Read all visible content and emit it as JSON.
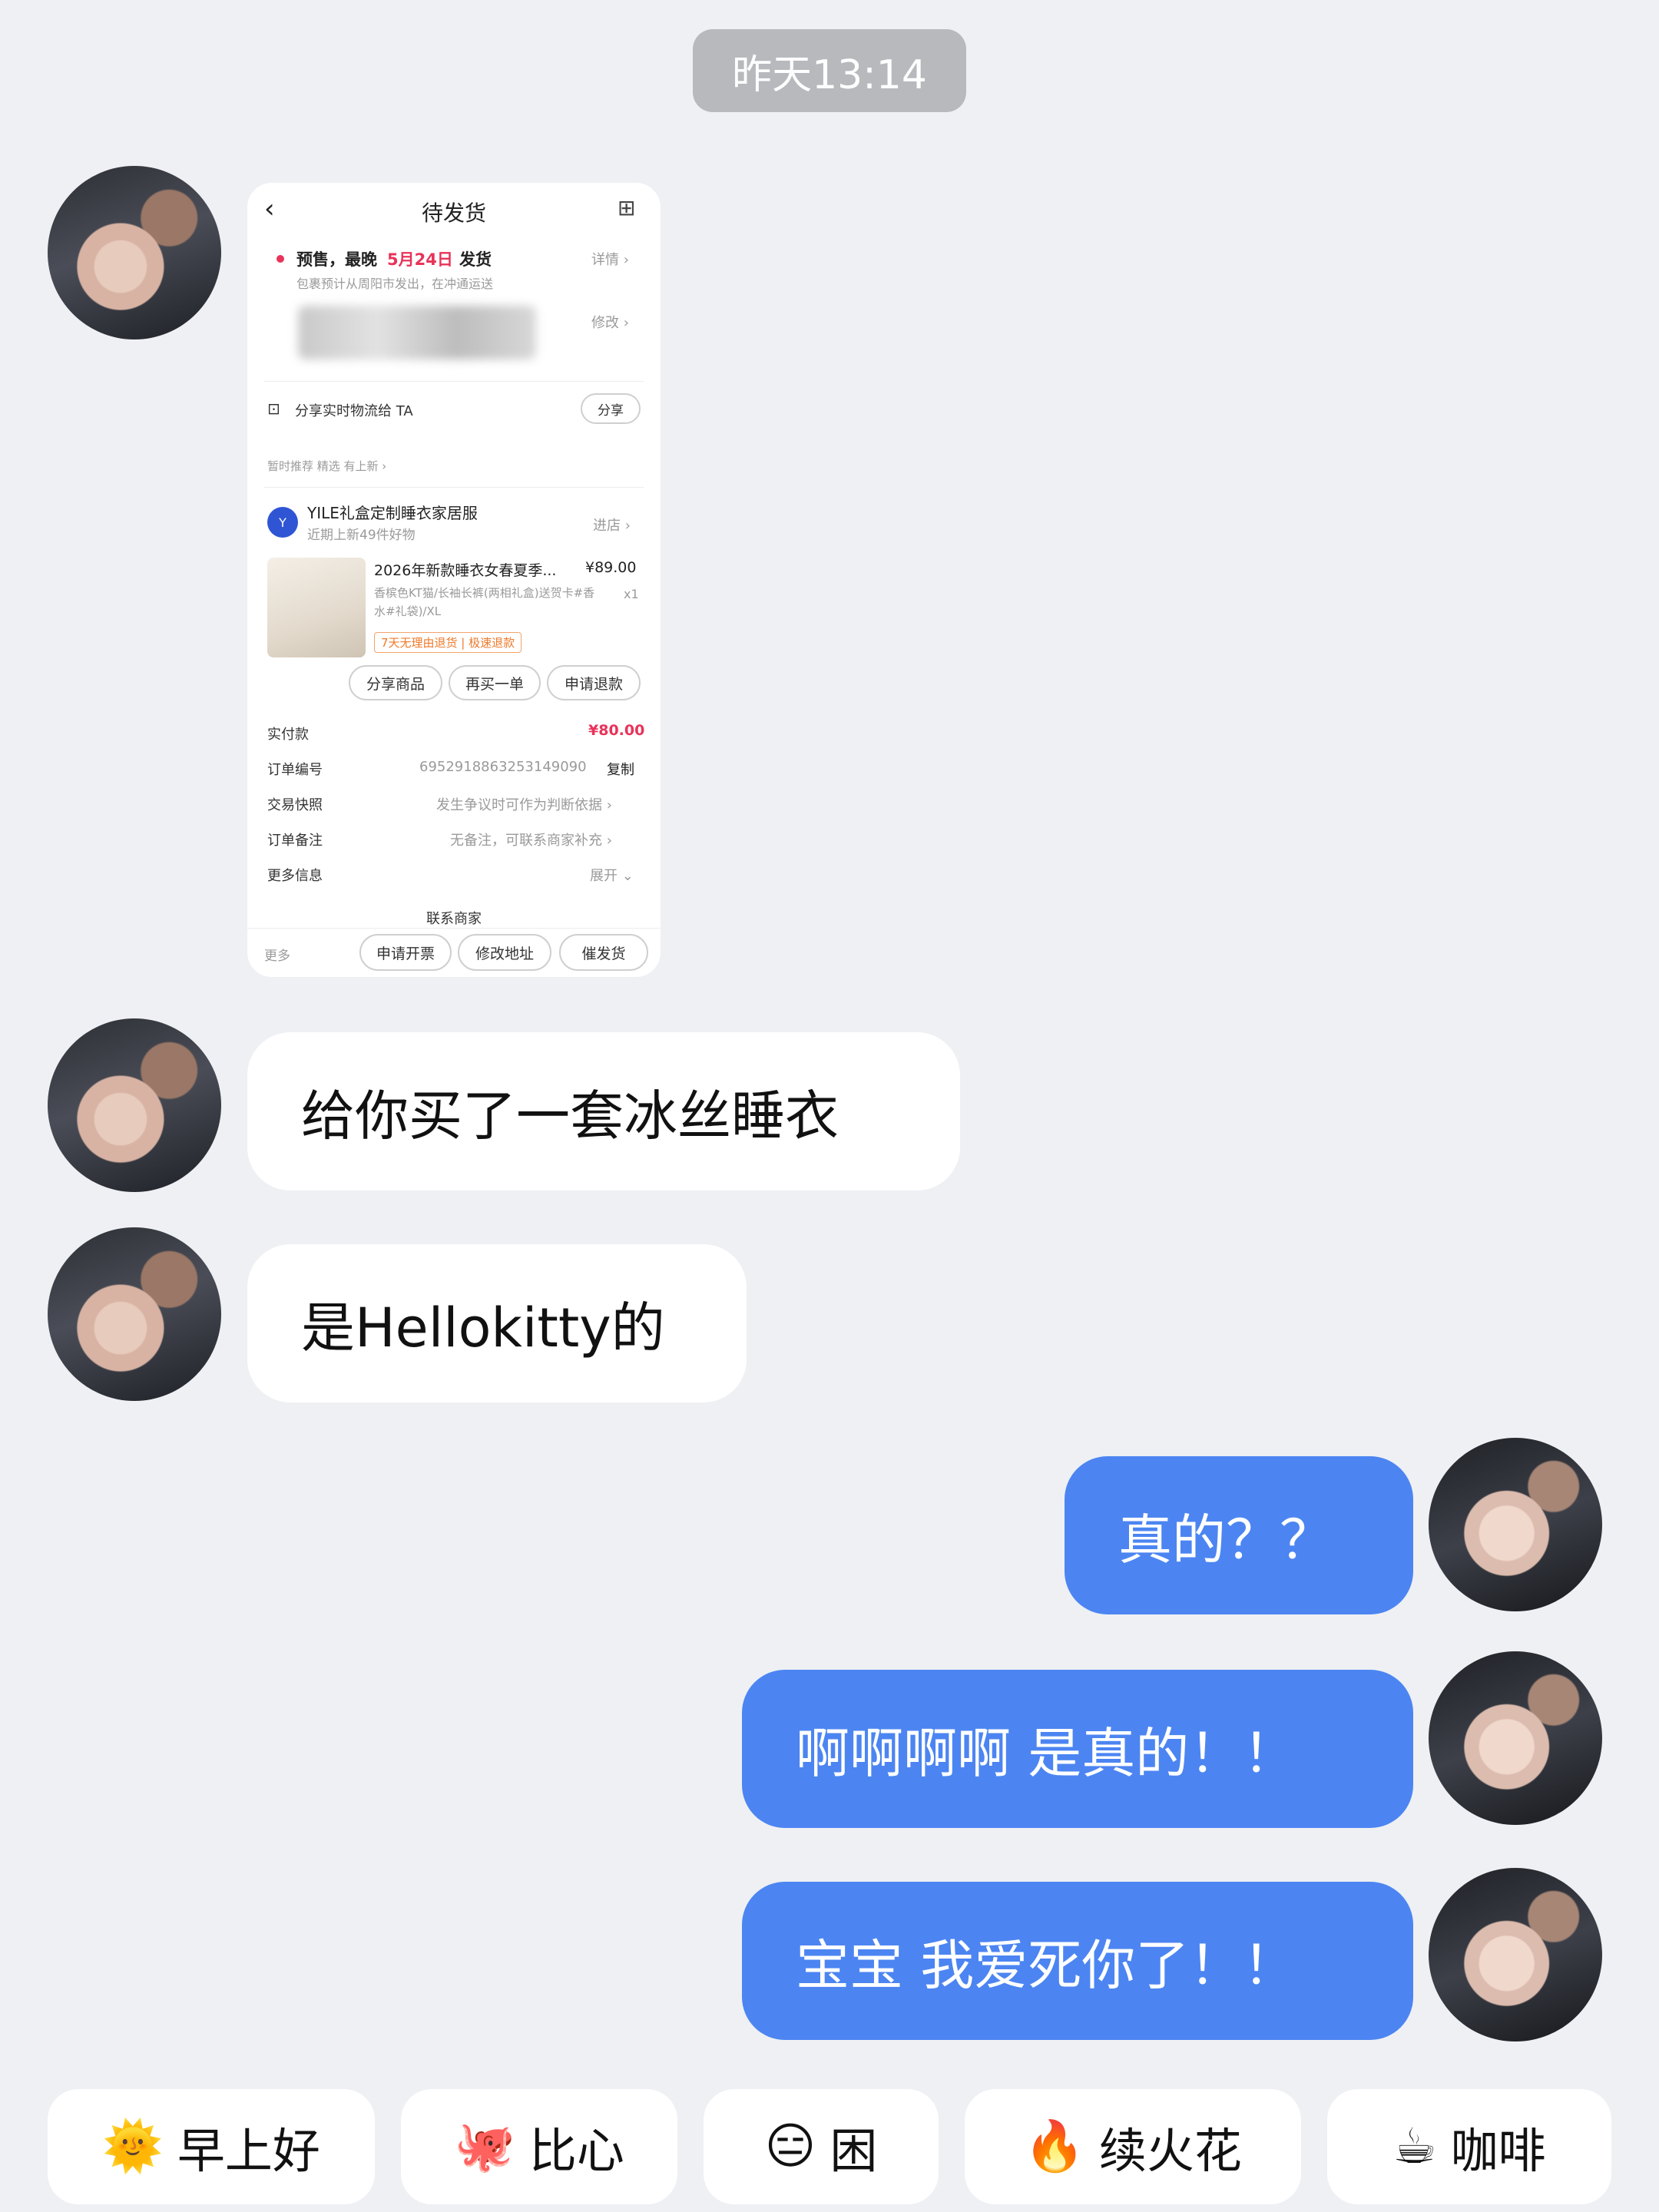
{
  "timestamp": "昨天13:14",
  "order_card": {
    "title": "待发货",
    "presale_prefix": "预售，最晚",
    "presale_date": "5月24日",
    "presale_suffix": "发货",
    "detail_link": "详情 ›",
    "shipping_note": "包裹预计从周阳市发出，在冲通运送",
    "modify_link": "修改 ›",
    "share_logistics": "分享实时物流给 TA",
    "share_button": "分享",
    "recommend_text": "暂时推荐 精选  有上新 ›",
    "shop_name": "YILE礼盒定制睡衣家居服",
    "shop_sub": "近期上新49件好物",
    "enter_shop": "进店 ›",
    "product_title": "2026年新款睡衣女春夏季...",
    "product_price": "¥89.00",
    "product_spec": "香槟色KT猫/长袖长裤(两相礼盒)送贺卡#香水#礼袋)/XL",
    "product_qty": "x1",
    "product_tag": "7天无理由退货 | 极速退款",
    "btn_share_product": "分享商品",
    "btn_buy_again": "再买一单",
    "btn_refund": "申请退款",
    "paid_label": "实付款",
    "paid_value": "¥80.00",
    "order_no_label": "订单编号",
    "order_no_value": "6952918863253149090",
    "copy_label": "复制",
    "snapshot_label": "交易快照",
    "snapshot_value": "发生争议时可作为判断依据 ›",
    "remark_label": "订单备注",
    "remark_value": "无备注，可联系商家补充 ›",
    "more_info_label": "更多信息",
    "more_info_value": "展开 ⌄",
    "contact_seller": "联系商家",
    "more_label": "更多",
    "btn_invoice": "申请开票",
    "btn_change_address": "修改地址",
    "btn_urge": "催发货"
  },
  "messages": [
    {
      "side": "in",
      "text": "给你买了一套冰丝睡衣"
    },
    {
      "side": "in",
      "text": "是Hellokitty的"
    },
    {
      "side": "out",
      "text": "真的？？"
    },
    {
      "side": "out",
      "text": "啊啊啊啊 是真的！！"
    },
    {
      "side": "out",
      "text": "宝宝 我爱死你了！！"
    }
  ],
  "quick_replies": [
    {
      "emoji": "🌞",
      "label": "早上好"
    },
    {
      "emoji": "🐙",
      "label": "比心"
    },
    {
      "emoji": "😑",
      "label": "困"
    },
    {
      "emoji": "🔥",
      "label": "续火花"
    },
    {
      "emoji": "☕",
      "label": "咖啡"
    }
  ],
  "colors": {
    "background": "#eef0f4",
    "outgoing_bubble": "#4c85f2",
    "incoming_bubble": "#ffffff",
    "timestamp_bg": "#b7b9bd",
    "price_red": "#e8335a"
  }
}
